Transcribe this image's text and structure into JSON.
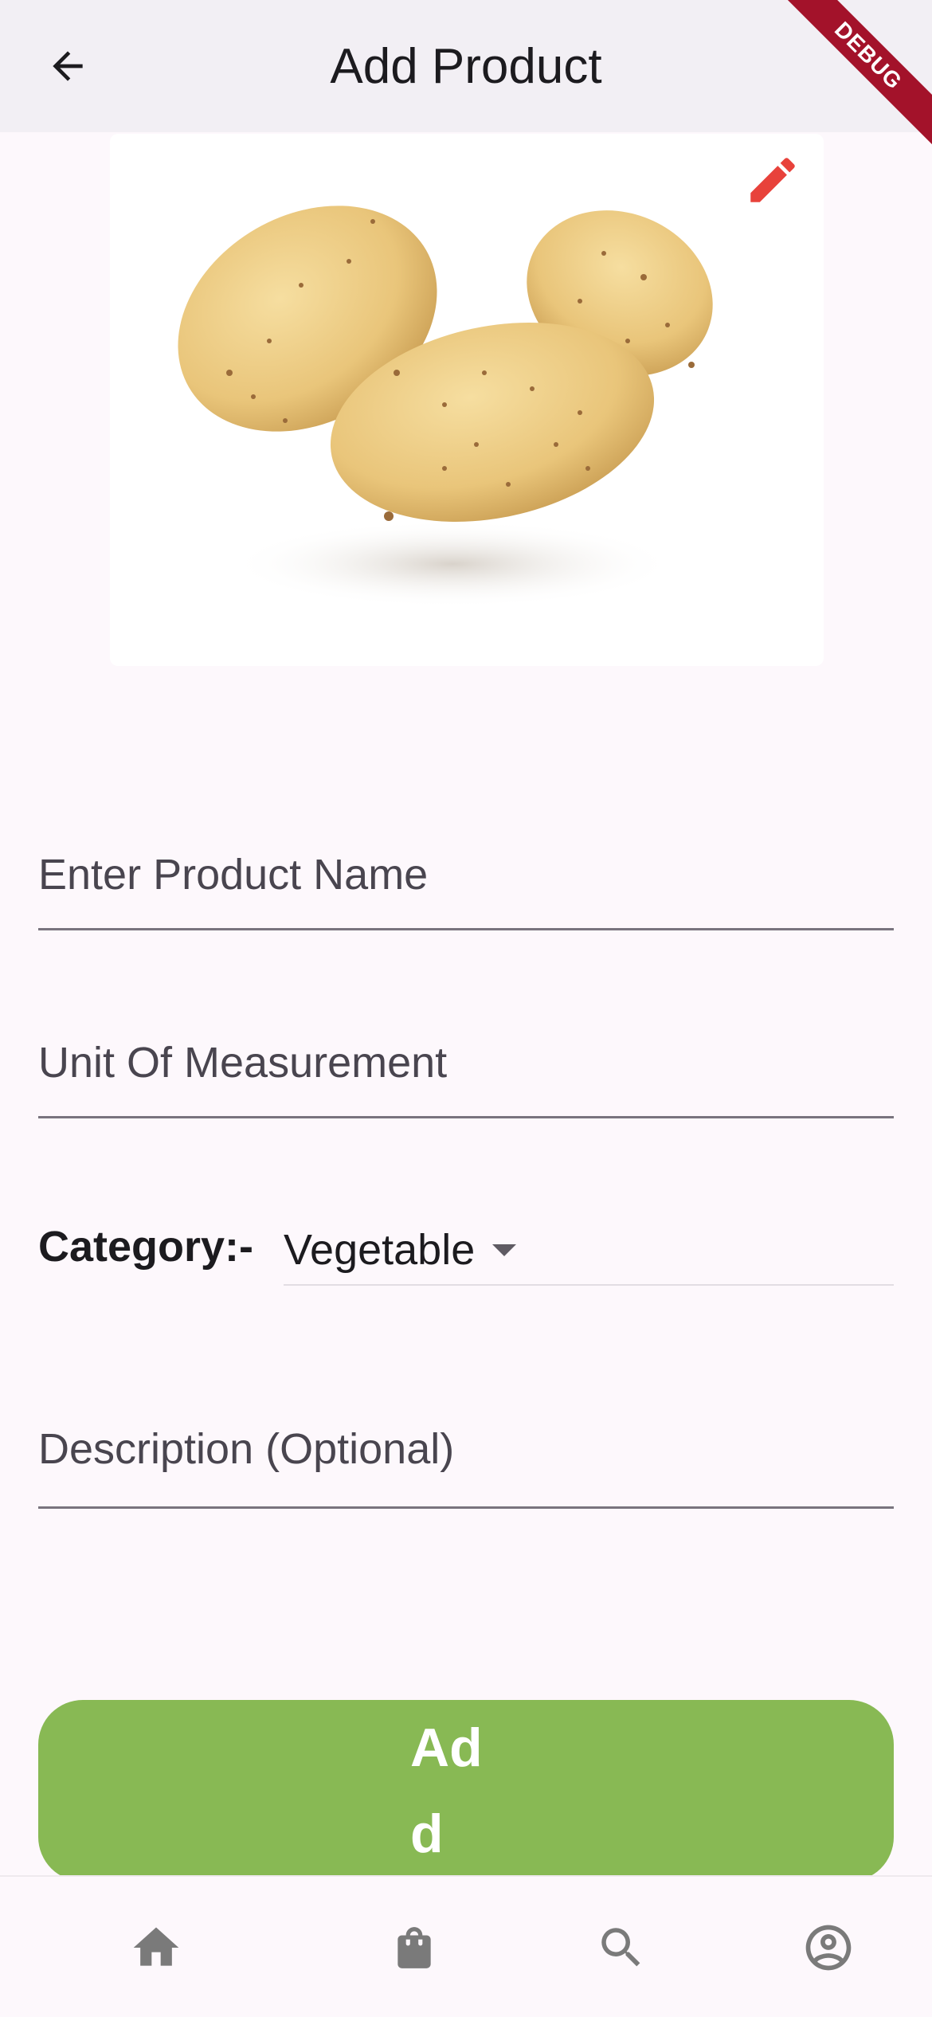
{
  "appbar": {
    "title": "Add Product",
    "back_icon": "arrow-back-icon"
  },
  "debug_banner": {
    "label": "DEBUG",
    "color": "#a3122a"
  },
  "product_image": {
    "icon": "edit-pencil-icon",
    "edit_color": "#e8423b"
  },
  "form": {
    "product_name": {
      "placeholder": "Enter Product Name",
      "value": ""
    },
    "unit": {
      "placeholder": "Unit Of Measurement",
      "value": ""
    },
    "category": {
      "label": "Category:-",
      "selected": "Vegetable"
    },
    "description": {
      "placeholder": "Description (Optional)",
      "value": ""
    }
  },
  "add_button": {
    "label": "Add",
    "color": "#88b954"
  },
  "bottom_nav": {
    "items": [
      {
        "icon": "home-icon"
      },
      {
        "icon": "shopping-bag-icon"
      },
      {
        "icon": "search-icon"
      },
      {
        "icon": "account-circle-icon"
      }
    ]
  }
}
